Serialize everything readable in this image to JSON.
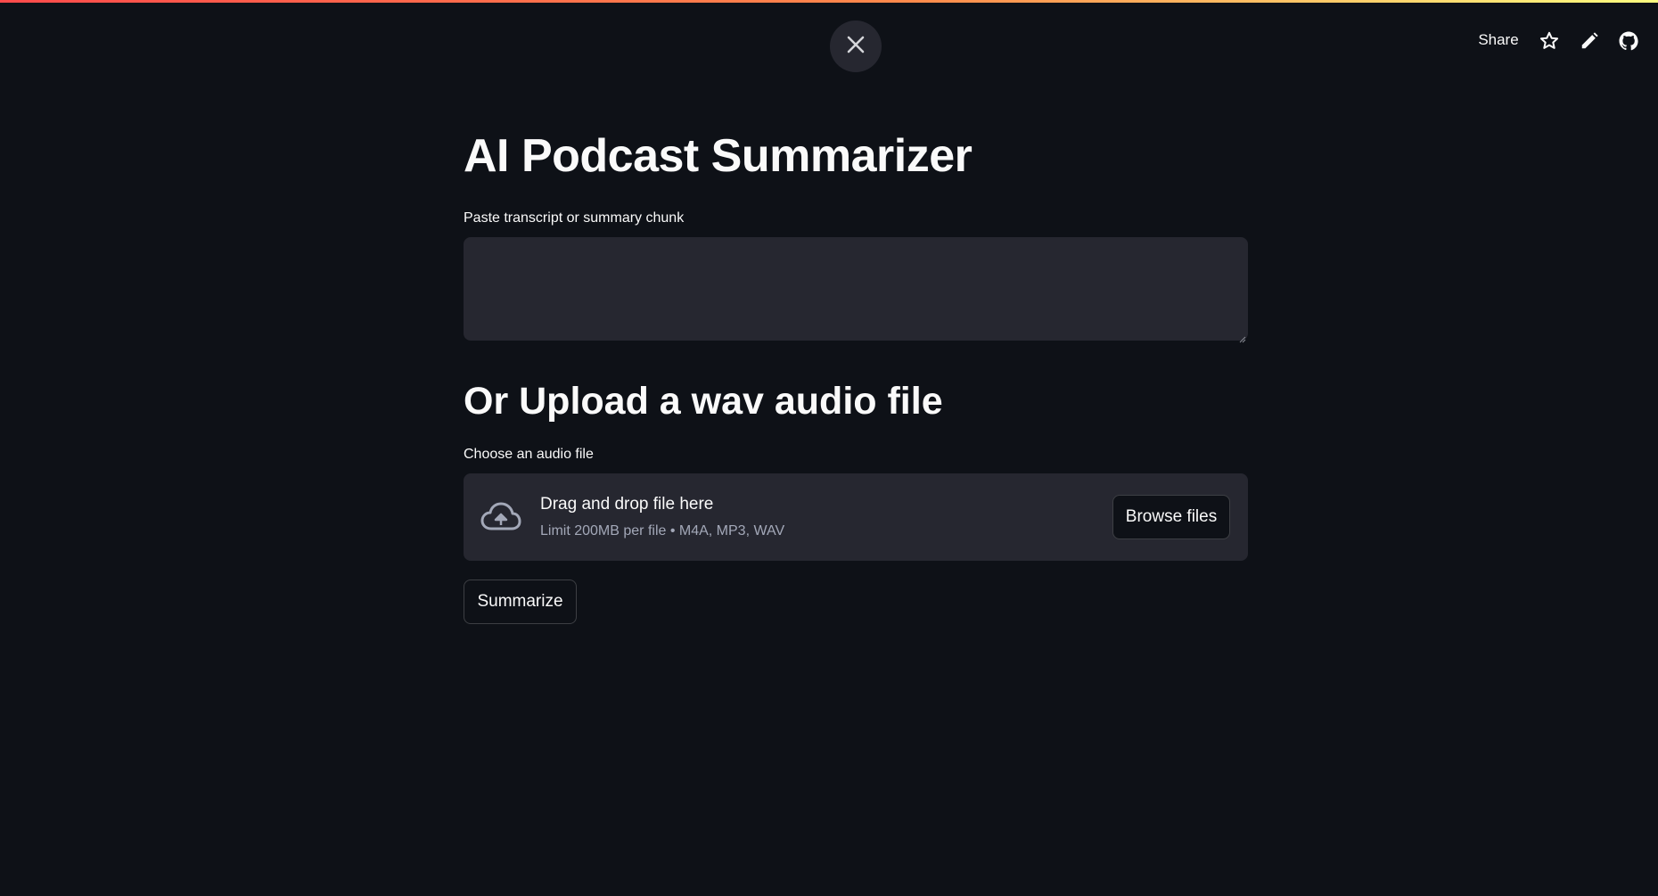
{
  "header": {
    "share_label": "Share",
    "icons": [
      "star-icon",
      "pencil-icon",
      "github-icon"
    ],
    "close_icon": "close-icon"
  },
  "main": {
    "title": "AI Podcast Summarizer",
    "transcript_label": "Paste transcript or summary chunk",
    "transcript_value": "",
    "upload_heading": "Or Upload a wav audio file",
    "uploader_label": "Choose an audio file",
    "dropzone": {
      "title": "Drag and drop file here",
      "limit_text": "Limit 200MB per file • M4A, MP3, WAV",
      "browse_label": "Browse files",
      "icon": "cloud-upload-icon"
    },
    "summarize_label": "Summarize"
  },
  "colors": {
    "background": "#0e1117",
    "surface": "#262730",
    "text": "#fafafa",
    "muted_text": "#a3a8b8",
    "accent_gradient_start": "#ff4b4b",
    "accent_gradient_end": "#fffd80"
  }
}
